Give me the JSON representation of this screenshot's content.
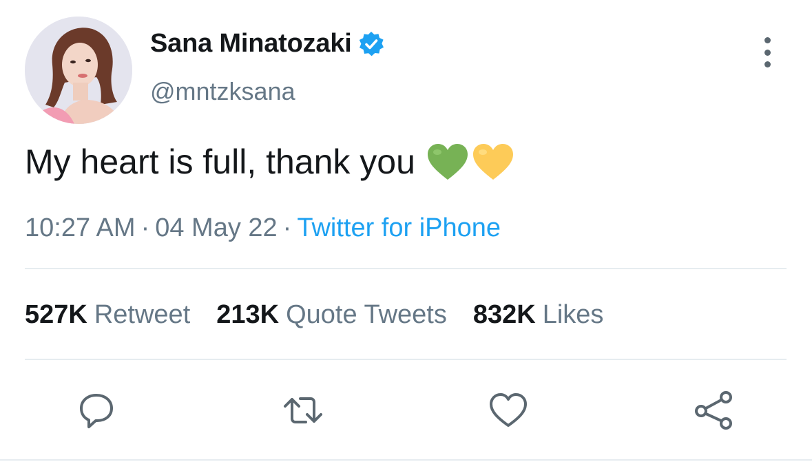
{
  "author": {
    "display_name": "Sana Minatozaki",
    "handle": "@mntzksana",
    "verified": true
  },
  "tweet": {
    "text": "My heart is full, thank you",
    "emoji": [
      "green-heart",
      "yellow-heart"
    ],
    "time": "10:27 AM",
    "date": "04 May 22",
    "separator": "·",
    "source": "Twitter for iPhone"
  },
  "stats": [
    {
      "count": "527K",
      "label": "Retweet"
    },
    {
      "count": "213K",
      "label": "Quote Tweets"
    },
    {
      "count": "832K",
      "label": "Likes"
    }
  ],
  "actions": [
    "reply-icon",
    "retweet-icon",
    "like-icon",
    "share-icon"
  ],
  "colors": {
    "text": "#14171a",
    "secondary": "#657786",
    "link": "#1da1f2",
    "verified": "#1da1f2",
    "divider": "#e6ecf0",
    "icon": "#5b6770"
  }
}
